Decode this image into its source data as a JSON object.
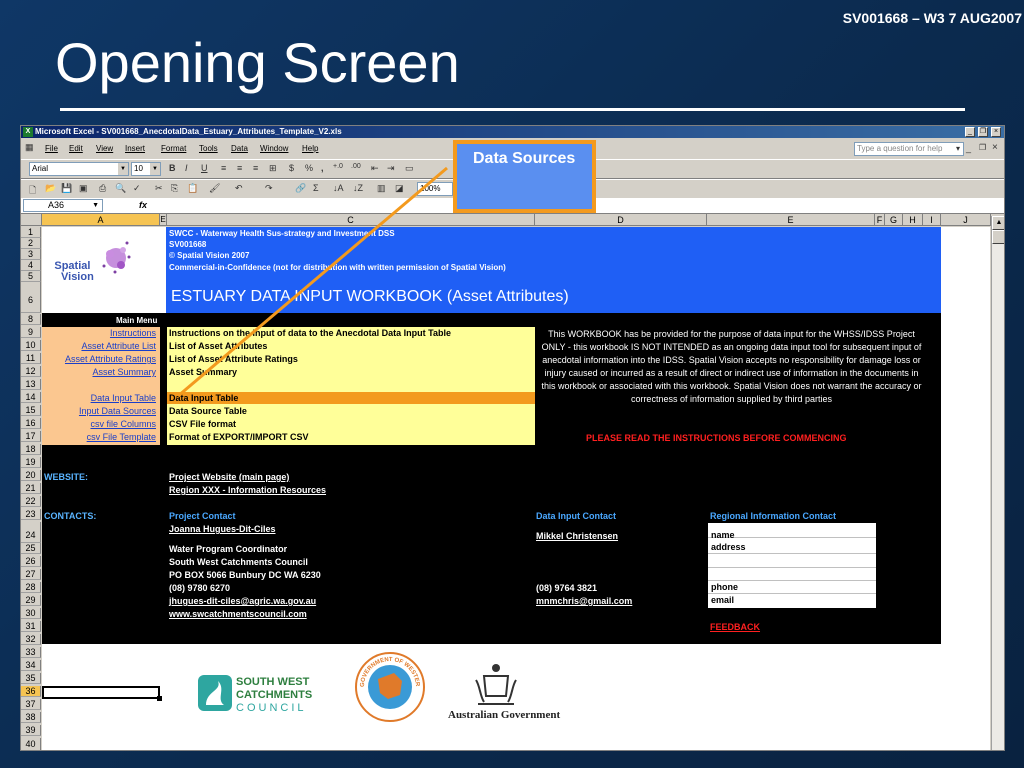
{
  "slide": {
    "id_text": "SV001668 – W3 7 AUG2007",
    "title": "Opening Screen"
  },
  "callout": {
    "label": "Data Sources",
    "color": "#f39a1e"
  },
  "window": {
    "title": "Microsoft Excel - SV001668_AnecdotalData_Estuary_Attributes_Template_V2.xls",
    "ask_placeholder": "Type a question for help"
  },
  "menubar": [
    "File",
    "Edit",
    "View",
    "Insert",
    "Format",
    "Tools",
    "Data",
    "Window",
    "Help"
  ],
  "toolbar": {
    "font": "Arial",
    "size": "10",
    "zoom": "100%"
  },
  "formula_bar": {
    "cell": "A36",
    "fx": "fx"
  },
  "columns": [
    "A",
    "E",
    "C",
    "D",
    "E",
    "F",
    "G",
    "H",
    "I",
    "J"
  ],
  "rows": [
    "1",
    "2",
    "3",
    "4",
    "5",
    "6",
    "8",
    "9",
    "10",
    "11",
    "12",
    "13",
    "14",
    "15",
    "16",
    "17",
    "18",
    "19",
    "20",
    "21",
    "22",
    "23",
    "24",
    "25",
    "26",
    "27",
    "28",
    "29",
    "30",
    "31",
    "32",
    "33",
    "34",
    "35",
    "36",
    "37",
    "38",
    "39",
    "40"
  ],
  "selected_row": "36",
  "logo": {
    "line1": "Spatial",
    "line2": "Vision"
  },
  "banner": {
    "line1": "SWCC - Waterway Health Sus-strategy and Investment DSS",
    "line2": "SV001668",
    "line3": "© Spatial Vision 2007",
    "line4": "Commercial-in-Confidence (not for distribution with written permission of Spatial Vision)",
    "title": "ESTUARY DATA INPUT WORKBOOK (Asset Attributes)"
  },
  "main_menu": {
    "title": "Main Menu",
    "items": [
      {
        "link": "Instructions",
        "desc": "Instructions on the input of data to the Anecdotal Data Input Table"
      },
      {
        "link": "Asset Attribute List",
        "desc": "List of Asset Attributes"
      },
      {
        "link": "Asset Attribute Ratings",
        "desc": "List of Asset Attribute Ratings"
      },
      {
        "link": "Asset Summary",
        "desc": "Asset Summary"
      },
      {
        "link": "Data Input Table",
        "desc": "Data Input Table"
      },
      {
        "link": "Input Data Sources",
        "desc": "Data Source Table"
      },
      {
        "link": "csv file Columns",
        "desc": "CSV File format"
      },
      {
        "link": "csv File Template",
        "desc": "Format of EXPORT/IMPORT CSV"
      }
    ]
  },
  "disclaimer": "This WORKBOOK has be provided for the purpose of data input for the WHSS/IDSS Project ONLY - this workbook IS NOT INTENDED as an ongoing data input tool for subsequent input of anecdotal information into the IDSS. Spatial Vision accepts no responsibility for damage loss or injury caused or incurred as a result of direct or indirect use of information in the documents in this workbook or associated with this workbook.  Spatial Vision does not warrant the accuracy or correctness of information supplied by third parties",
  "warning": "PLEASE READ THE INSTRUCTIONS BEFORE COMMENCING",
  "website": {
    "label": "WEBSITE:",
    "link1": "Project Website (main page)",
    "link2": "Region XXX - Information Resources"
  },
  "contacts": {
    "label": "CONTACTS:",
    "project": {
      "heading": "Project Contact",
      "name": "Joanna Hugues-Dit-Ciles",
      "role": "Water Program Coordinator",
      "org": "South West Catchments Council",
      "address": "PO BOX 5066 Bunbury DC WA 6230",
      "phone": "(08) 9780 6270",
      "email": "jhugues-dit-ciles@agric.wa.gov.au",
      "web": "www.swcatchmentscouncil.com"
    },
    "data_input": {
      "heading": "Data Input Contact",
      "name": "Mikkel Christensen",
      "phone": "(08) 9764 3821",
      "email": "mnmchris@gmail.com"
    },
    "regional": {
      "heading": "Regional Information Contact",
      "name": "name",
      "address": "address",
      "phone": "phone",
      "email": "email"
    },
    "feedback": "FEEDBACK"
  },
  "logos": {
    "swcc": {
      "line1": "SOUTH WEST",
      "line2": "CATCHMENTS",
      "line3": "COUNCIL"
    },
    "wa": {
      "text": "GOVERNMENT OF WESTERN AUSTRALIA"
    },
    "aus": {
      "text": "Australian Government"
    }
  }
}
